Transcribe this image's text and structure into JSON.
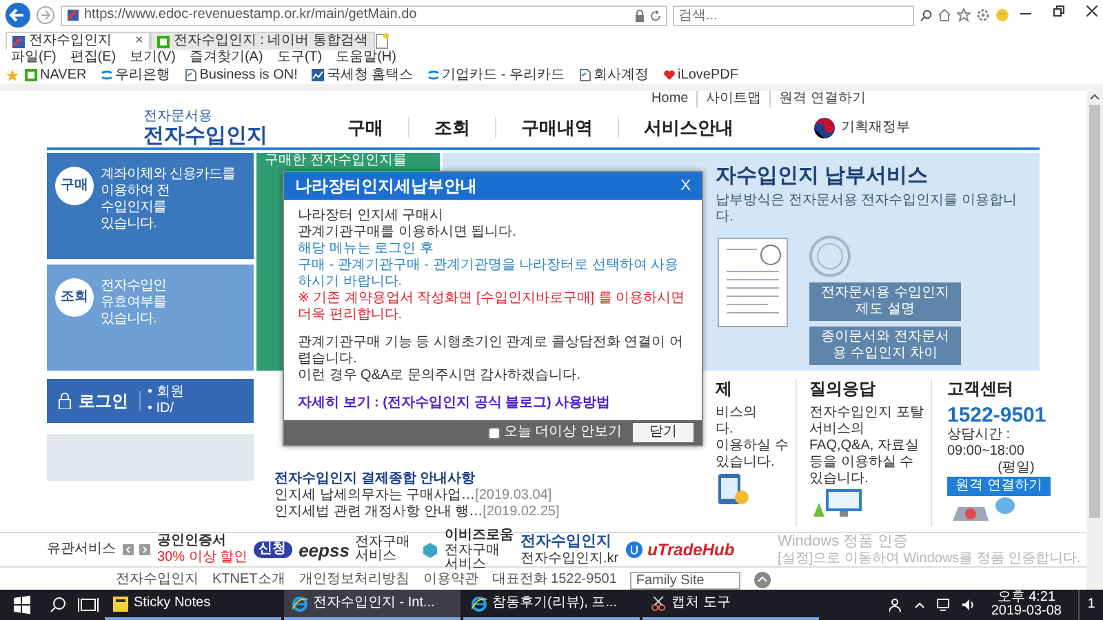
{
  "browser": {
    "url": "https://www.edoc-revenuestamp.or.kr/main/getMain.do",
    "search_placeholder": "검색...",
    "tabs": [
      {
        "label": "전자수입인지",
        "selected": true,
        "close": "×"
      },
      {
        "label": "전자수입인지 : 네이버 통합검색",
        "selected": false
      }
    ],
    "menu": [
      "파일(F)",
      "편집(E)",
      "보기(V)",
      "즐겨찾기(A)",
      "도구(T)",
      "도움말(H)"
    ],
    "favorites": [
      {
        "label": "NAVER",
        "kind": "naver"
      },
      {
        "label": "우리은행",
        "kind": "bank"
      },
      {
        "label": "Business is ON!",
        "kind": "page"
      },
      {
        "label": "국세청 홈택스",
        "kind": "tax"
      },
      {
        "label": "기업카드 - 우리카드",
        "kind": "bank"
      },
      {
        "label": "회사계정",
        "kind": "page"
      },
      {
        "label": "iLovePDF",
        "kind": "heart"
      }
    ]
  },
  "site": {
    "top_links": [
      "Home",
      "사이트맵",
      "원격 연결하기"
    ],
    "logo": {
      "small": "전자문서용",
      "main": "전자수입인지"
    },
    "nav": [
      "구매",
      "조회",
      "구매내역",
      "서비스안내"
    ],
    "ministry": "기획재정부",
    "tiles": [
      {
        "kind": "buy",
        "badge": "구매",
        "lines": [
          "계좌이체와 신용카드를",
          "이용하여 전",
          "수입인지를",
          "있습니다."
        ]
      },
      {
        "kind": "lookup",
        "badge": "조회",
        "lines": [
          "전자수입인",
          "유효여부를",
          "있습니다."
        ]
      }
    ],
    "notice_tile": {
      "text": "구매한 전자수입인지를"
    },
    "banner": {
      "title": "자수입인지 납부서비스",
      "subtitle": "납부방식은 전자문서용 전자수입인지를 이용합니다.",
      "buttons": [
        "전자문서용 수입인지 제도 설명",
        "종이문서와 전자문서용 수입인지 차이"
      ]
    },
    "login": {
      "label": "로그인",
      "items": [
        "• 회원",
        "• ID/"
      ]
    },
    "news": {
      "headline": "전자수입인지 결제종합 안내사항",
      "items": [
        {
          "title": "인지세 납세의무자는 구매사업…",
          "date": "[2019.03.04]"
        },
        {
          "title": "인지세법 관련 개정사항 안내 행…",
          "date": "[2019.02.25]"
        }
      ]
    },
    "payment": {
      "heading": "제",
      "lines": [
        "비스의",
        "다.",
        "이용하실 수",
        "있습니다."
      ]
    },
    "qna": {
      "heading": "질의응답",
      "text": "전자수입인지 포탈 서비스의 FAQ,Q&A, 자료실 등을 이용하실 수 있습니다."
    },
    "support": {
      "heading": "고객센터",
      "phone": "1522-9501",
      "hours": "상담시간 : 09:00~18:00",
      "days": "(평일)",
      "button": "원격 연결하기"
    },
    "related": {
      "label": "유관서비스"
    },
    "partners": [
      {
        "kind": "tradesign",
        "name": "공인인증서",
        "caption": "30% 이상 할인",
        "tag": "신청"
      },
      {
        "kind": "eepss",
        "name": "eepss",
        "caption": "전자구매서비스"
      },
      {
        "kind": "ebiz",
        "name": "이비즈로움",
        "caption": "전자구매서비스"
      },
      {
        "kind": "stamp",
        "name": "전자수입인지",
        "caption": "전자수입인지.kr"
      },
      {
        "kind": "utrade",
        "name": "uTradeHub"
      }
    ],
    "footer": {
      "title": "전자수입인지",
      "links": [
        "KTNET소개",
        "개인정보처리방침",
        "이용약관",
        "대표전화 1522-9501"
      ],
      "family_site": "Family Site"
    }
  },
  "activation": {
    "title": "Windows 정품 인증",
    "text": "[설정]으로 이동하여 Windows를 정품 인증합니다."
  },
  "modal": {
    "title": "나라장터인지세납부안내",
    "close": "X",
    "blocks": [
      {
        "kind": "plain",
        "lines": [
          "나라장터 인지세 구매시",
          "관계기관구매를 이용하시면 됩니다."
        ]
      },
      {
        "kind": "info",
        "lines": [
          "해당 메뉴는 로그인 후",
          "구매 - 관계기관구매 - 관계기관명을 나라장터로 선택하여 사용하시기 바랍니다."
        ]
      },
      {
        "kind": "warning",
        "lines": [
          "※ 기존 계약용업서 작성화면 [수입인지바로구매] 를 이용하시면 더욱 편리합니다."
        ]
      },
      {
        "kind": "plain",
        "lines": [
          "관계기관구매 기능 등 시행초기인 관계로 콜상담전화 연결이 어렵습니다.",
          "이런 경우 Q&A로 문의주시면 감사하겠습니다."
        ]
      },
      {
        "kind": "link",
        "lines": [
          "자세히 보기 : (전자수입인지 공식 블로그) 사용방법"
        ]
      }
    ],
    "dont_show": {
      "label": "오늘 더이상 안보기",
      "checked": false
    },
    "button": "닫기"
  },
  "taskbar": {
    "apps": [
      {
        "label": "Sticky Notes",
        "kind": "notes",
        "selected": false
      },
      {
        "label": "전자수입인지 - Int...",
        "kind": "ie",
        "selected": true
      },
      {
        "label": "참동후기(리뷰), 프...",
        "kind": "ie",
        "selected": false
      },
      {
        "label": "캡처 도구",
        "kind": "snip",
        "selected": false
      }
    ],
    "time": "오후 4:21",
    "date": "2019-03-08",
    "notifications": "1"
  }
}
